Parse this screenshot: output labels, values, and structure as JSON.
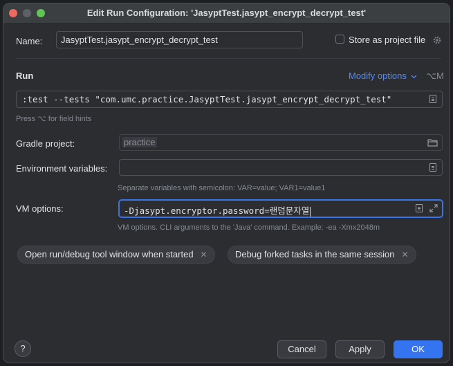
{
  "window": {
    "title": "Edit Run Configuration: 'JasyptTest.jasypt_encrypt_decrypt_test'"
  },
  "name_row": {
    "label": "Name:",
    "value": "JasyptTest.jasypt_encrypt_decrypt_test",
    "store_label": "Store as project file",
    "store_checked": false
  },
  "run_section": {
    "heading": "Run",
    "modify_options": "Modify options",
    "modify_shortcut": "⌥M",
    "command": ":test --tests \"com.umc.practice.JasyptTest.jasypt_encrypt_decrypt_test\"",
    "field_hint": "Press ⌥ for field hints"
  },
  "gradle_project": {
    "label": "Gradle project:",
    "value": "practice"
  },
  "environment_variables": {
    "label": "Environment variables:",
    "value": "",
    "hint": "Separate variables with semicolon: VAR=value; VAR1=value1"
  },
  "vm_options": {
    "label": "VM options:",
    "value": "-Djasypt.encryptor.password=랜덤문자열",
    "hint": "VM options. CLI arguments to the 'Java' command. Example: -ea -Xmx2048m"
  },
  "chips": [
    {
      "label": "Open run/debug tool window when started"
    },
    {
      "label": "Debug forked tasks in the same session"
    }
  ],
  "footer": {
    "help": "?",
    "cancel": "Cancel",
    "apply": "Apply",
    "ok": "OK"
  },
  "colors": {
    "accent": "#3574f0",
    "link": "#548af7",
    "background": "#2b2d30",
    "text": "#dfe1e5"
  },
  "icons": [
    "doc-icon",
    "folder-icon",
    "gear-icon",
    "expand-icon",
    "chevron-down-icon",
    "close-icon",
    "help-icon"
  ]
}
